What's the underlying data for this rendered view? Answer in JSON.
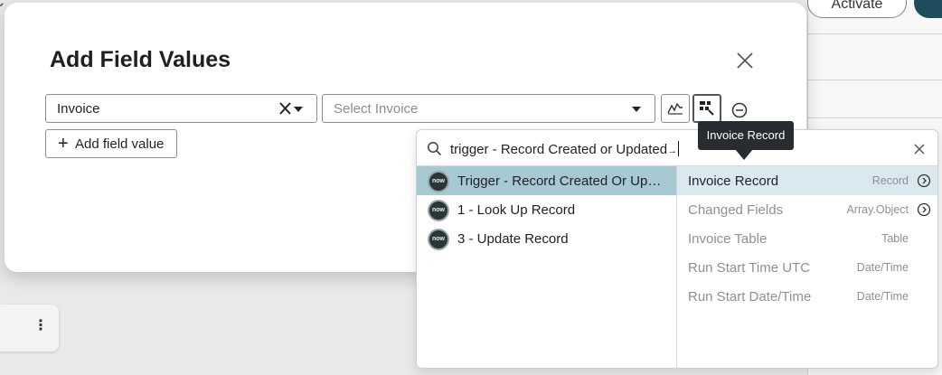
{
  "background": {
    "activate_label": "Activate"
  },
  "modal": {
    "title": "Add Field Values",
    "field_select": {
      "value": "Invoice"
    },
    "value_select": {
      "placeholder": "Select Invoice"
    },
    "add_button_label": "Add field value"
  },
  "picker": {
    "search_value": "trigger - Record Created or Updated",
    "steps": [
      {
        "badge": "now",
        "label": "Trigger - Record Created Or Updated",
        "selected": true
      },
      {
        "badge": "now",
        "label": "1 - Look Up Record",
        "selected": false
      },
      {
        "badge": "now",
        "label": "3 - Update Record",
        "selected": false
      }
    ],
    "pills": [
      {
        "name": "Invoice Record",
        "type": "Record",
        "has_children": true,
        "enabled": true
      },
      {
        "name": "Changed Fields",
        "type": "Array.Object",
        "has_children": true,
        "enabled": false
      },
      {
        "name": "Invoice Table",
        "type": "Table",
        "has_children": false,
        "enabled": false
      },
      {
        "name": "Run Start Time UTC",
        "type": "Date/Time",
        "has_children": false,
        "enabled": false
      },
      {
        "name": "Run Start Date/Time",
        "type": "Date/Time",
        "has_children": false,
        "enabled": false
      }
    ]
  },
  "tooltip": {
    "text": "Invoice Record"
  },
  "colors": {
    "selected_step": "#a6c9d4",
    "selected_pill": "#d9e9ef",
    "tooltip_bg": "#282b30",
    "brand_dark": "#1f4c5c"
  },
  "icons": {
    "close": "close-icon",
    "clear": "clear-x-icon",
    "caret": "chevron-down-icon",
    "data_pill_picker": "data-pill-picker-icon",
    "pill_tree": "pill-tree-icon",
    "remove": "minus-circle-icon",
    "search": "search-icon",
    "drill": "chevron-right-circle-icon"
  }
}
